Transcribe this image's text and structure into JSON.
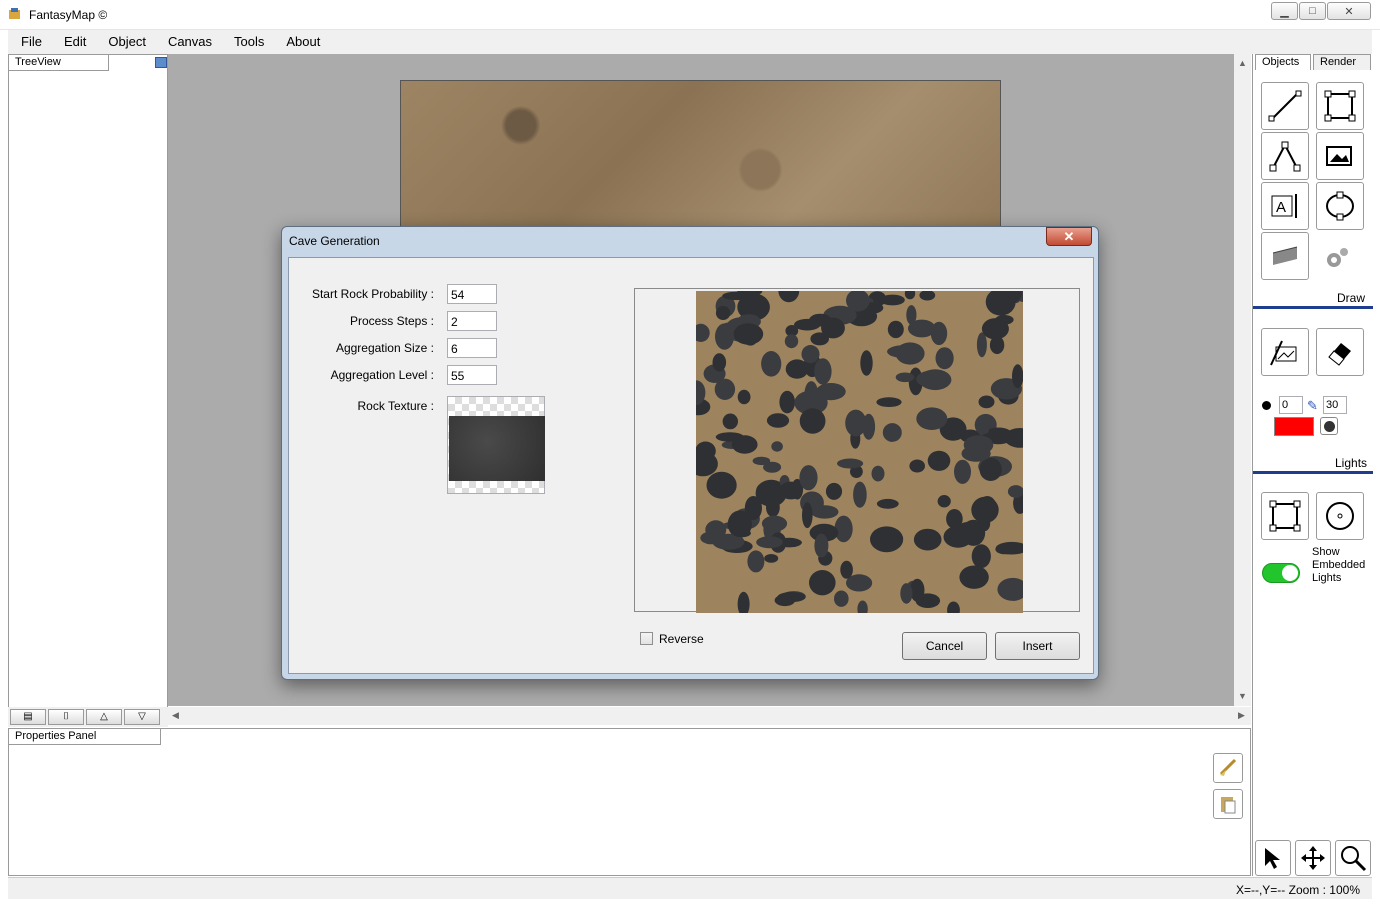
{
  "window": {
    "title": "FantasyMap ©",
    "buttons": [
      "▁",
      "□",
      "✕"
    ]
  },
  "menu": [
    "File",
    "Edit",
    "Object",
    "Canvas",
    "Tools",
    "About"
  ],
  "treeview": {
    "header": "TreeView"
  },
  "properties": {
    "header": "Properties Panel"
  },
  "right_panel": {
    "tabs": [
      "Objects",
      "Render"
    ],
    "draw_label": "Draw",
    "lights_label": "Lights",
    "brush_size": "0",
    "brush_width": "30",
    "show_embedded_lights": "Show Embedded Lights",
    "toggle_on": true
  },
  "status": {
    "text": "X=--,Y=--   Zoom : 100%"
  },
  "dialog": {
    "title": "Cave Generation",
    "close": "✕",
    "fields": [
      {
        "label": "Start Rock Probability :",
        "value": "54"
      },
      {
        "label": "Process Steps :",
        "value": "2"
      },
      {
        "label": "Aggregation Size :",
        "value": "6"
      },
      {
        "label": "Aggregation Level :",
        "value": "55"
      }
    ],
    "rock_texture_label": "Rock Texture :",
    "reverse_label": "Reverse",
    "cancel_label": "Cancel",
    "insert_label": "Insert"
  }
}
